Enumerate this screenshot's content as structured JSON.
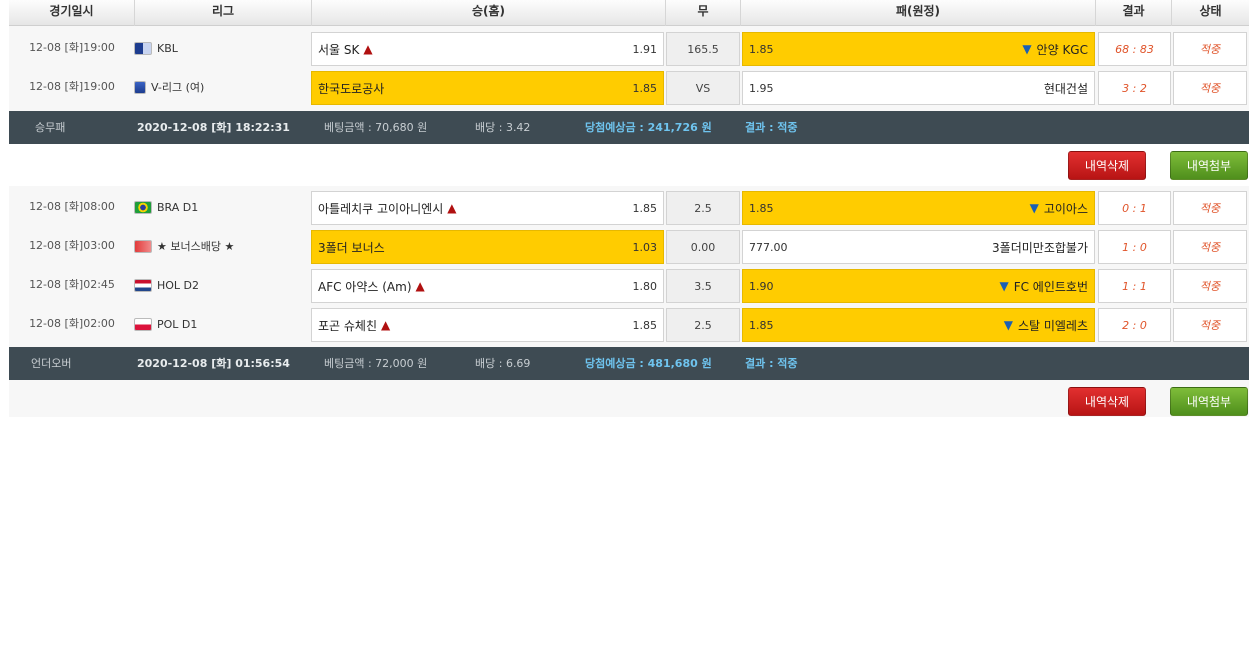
{
  "header": {
    "date": "경기일시",
    "league": "리그",
    "home": "승(홈)",
    "draw": "무",
    "away": "패(원정)",
    "result": "결과",
    "status": "상태"
  },
  "slips": [
    {
      "games": [
        {
          "date": "12-08 [화]19:00",
          "league": "KBL",
          "home": "서울 SK",
          "home_arrow": "up",
          "home_odd": "1.91",
          "draw": "165.5",
          "away": "안양 KGC",
          "away_arrow": "down",
          "away_odd": "1.85",
          "selected": "away",
          "result": "68 : 83",
          "status": "적중"
        },
        {
          "date": "12-08 [화]19:00",
          "league": "V-리그 (여)",
          "home": "한국도로공사",
          "home_arrow": "",
          "home_odd": "1.85",
          "draw": "VS",
          "away": "현대건설",
          "away_arrow": "",
          "away_odd": "1.95",
          "selected": "home",
          "result": "3 : 2",
          "status": "적중"
        }
      ],
      "summary": {
        "type": "승무패",
        "datetime": "2020-12-08 [화] 18:22:31",
        "bet_amount": "베팅금액 : 70,680 원",
        "odds": "배당 : 3.42",
        "expected": "당첨예상금 : 241,726 원",
        "result": "결과 : 적중"
      }
    },
    {
      "games": [
        {
          "date": "12-08 [화]08:00",
          "league": "BRA D1",
          "home": "아틀레치쿠 고이아니엔시",
          "home_arrow": "up",
          "home_odd": "1.85",
          "draw": "2.5",
          "away": "고이아스",
          "away_arrow": "down",
          "away_odd": "1.85",
          "selected": "away",
          "result": "0 : 1",
          "status": "적중"
        },
        {
          "date": "12-08 [화]03:00",
          "league": "★ 보너스배당 ★",
          "home": "3폴더 보너스",
          "home_arrow": "",
          "home_odd": "1.03",
          "draw": "0.00",
          "away": "3폴더미만조합불가",
          "away_arrow": "",
          "away_odd": "777.00",
          "selected": "home",
          "result": "1 : 0",
          "status": "적중"
        },
        {
          "date": "12-08 [화]02:45",
          "league": "HOL D2",
          "home": "AFC 아약스 (Am)",
          "home_arrow": "up",
          "home_odd": "1.80",
          "draw": "3.5",
          "away": "FC 에인트호번",
          "away_arrow": "down",
          "away_odd": "1.90",
          "selected": "away",
          "result": "1 : 1",
          "status": "적중"
        },
        {
          "date": "12-08 [화]02:00",
          "league": "POL D1",
          "home": "포곤 슈체친",
          "home_arrow": "up",
          "home_odd": "1.85",
          "draw": "2.5",
          "away": "스탈 미엘레츠",
          "away_arrow": "down",
          "away_odd": "1.85",
          "selected": "away",
          "result": "2 : 0",
          "status": "적중"
        }
      ],
      "summary": {
        "type": "언더오버",
        "datetime": "2020-12-08 [화] 01:56:54",
        "bet_amount": "베팅금액 : 72,000 원",
        "odds": "배당 : 6.69",
        "expected": "당첨예상금 : 481,680 원",
        "result": "결과 : 적중"
      }
    }
  ],
  "actions": {
    "delete": "내역삭제",
    "attach": "내역첨부"
  },
  "colors": {
    "selected": "#ffcc00",
    "summary_bg": "#3e4b53",
    "win_text": "#6fc4ef",
    "result_text": "#e0542a"
  },
  "icons": {
    "up": "up-arrow-icon",
    "down": "down-arrow-icon"
  }
}
